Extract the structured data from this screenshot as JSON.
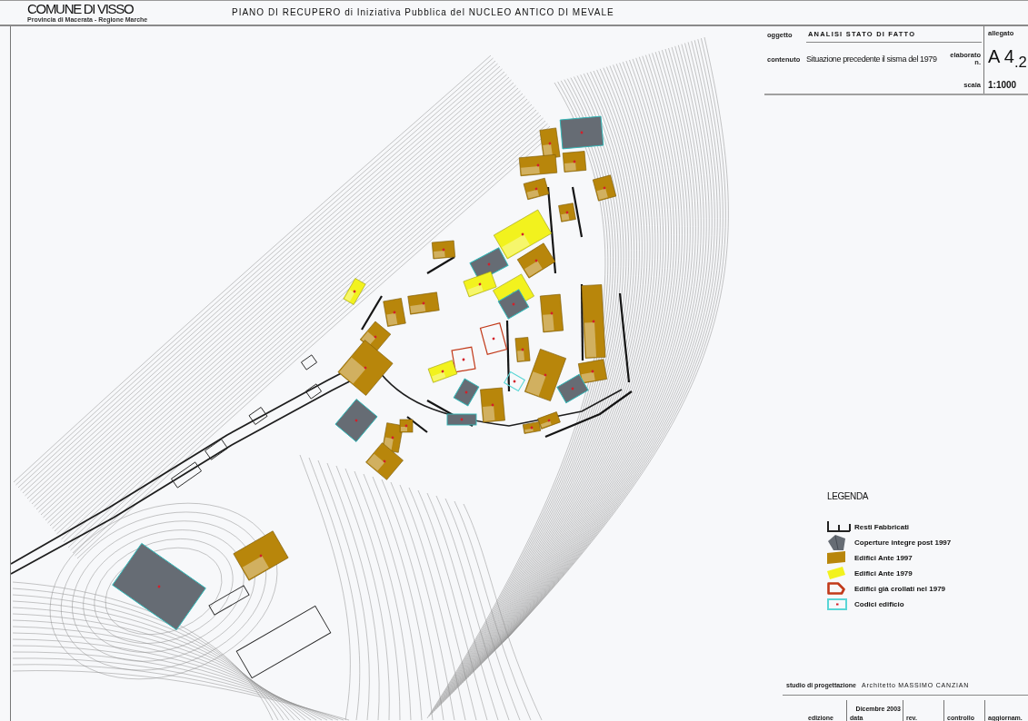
{
  "header": {
    "municipality": "COMUNE DI VISSO",
    "region": "Provincia di Macerata - Regione Marche",
    "title": "PIANO DI RECUPERO di Iniziativa Pubblica del NUCLEO ANTICO DI MEVALE"
  },
  "title_block": {
    "subject_label": "oggetto",
    "subject": "ANALISI STATO DI FATTO",
    "content_label": "contenuto",
    "content": "Situazione precedente il sisma del 1979",
    "sheet_label": "elaborato n.",
    "attachment_label": "allegato",
    "sheet": "A 4$_{.2}$",
    "scale_label": "scala",
    "scale": "1:1000"
  },
  "map": {
    "buildings": [
      {
        "kind": "roof_intact"
      },
      {
        "kind": "ante_1997"
      },
      {
        "kind": "ante_1997"
      },
      {
        "kind": "ante_1997"
      },
      {
        "kind": "ante_1997"
      },
      {
        "kind": "ante_1997"
      },
      {
        "kind": "ante_1997"
      },
      {
        "kind": "ante_1979"
      },
      {
        "kind": "ante_1997"
      },
      {
        "kind": "roof_intact"
      },
      {
        "kind": "ante_1997"
      },
      {
        "kind": "ante_1979"
      },
      {
        "kind": "ante_1979"
      },
      {
        "kind": "ante_1979"
      },
      {
        "kind": "ante_1997"
      },
      {
        "kind": "ante_1997"
      },
      {
        "kind": "roof_intact"
      },
      {
        "kind": "ante_1997"
      },
      {
        "kind": "ante_1997"
      },
      {
        "kind": "ante_1997"
      },
      {
        "kind": "collapsed"
      },
      {
        "kind": "collapsed"
      },
      {
        "kind": "ante_1979"
      },
      {
        "kind": "ante_1997"
      },
      {
        "kind": "ante_1997"
      },
      {
        "kind": "ante_1997"
      },
      {
        "kind": "ante_1997"
      },
      {
        "kind": "roof_intact"
      },
      {
        "kind": "roof_intact"
      },
      {
        "kind": "ante_1997"
      },
      {
        "kind": "code"
      },
      {
        "kind": "roof_intact"
      },
      {
        "kind": "ante_1997"
      },
      {
        "kind": "ante_1997"
      },
      {
        "kind": "roof_intact"
      },
      {
        "kind": "ante_1997"
      },
      {
        "kind": "ante_1997"
      },
      {
        "kind": "ante_1997"
      },
      {
        "kind": "ante_1997"
      },
      {
        "kind": "roof_intact"
      }
    ]
  },
  "legend": {
    "title": "LEGENDA",
    "items": [
      {
        "kind": "remains",
        "label": "Resti Fabbricati"
      },
      {
        "kind": "roof_intact",
        "label": "Coperture integre post 1997",
        "color": "#666c74"
      },
      {
        "kind": "ante_1997",
        "label": "Edifici Ante 1997",
        "color": "#b8860b"
      },
      {
        "kind": "ante_1979",
        "label": "Edifici Ante 1979",
        "color": "#f2f21e"
      },
      {
        "kind": "collapsed",
        "label": "Edifici già crollati nel 1979",
        "color": "#c23a1a"
      },
      {
        "kind": "code",
        "label": "Codici edificio",
        "color": "#5ad6d6"
      }
    ]
  },
  "credits": {
    "studio_label": "studio di progettazione",
    "architect": "Architetto MASSIMO CANZIAN",
    "fields": [
      {
        "label": "edizione"
      },
      {
        "label": "data",
        "value": "Dicembre 2003"
      },
      {
        "label": "rev."
      },
      {
        "label": "controllo"
      },
      {
        "label": "aggiornam."
      }
    ]
  }
}
